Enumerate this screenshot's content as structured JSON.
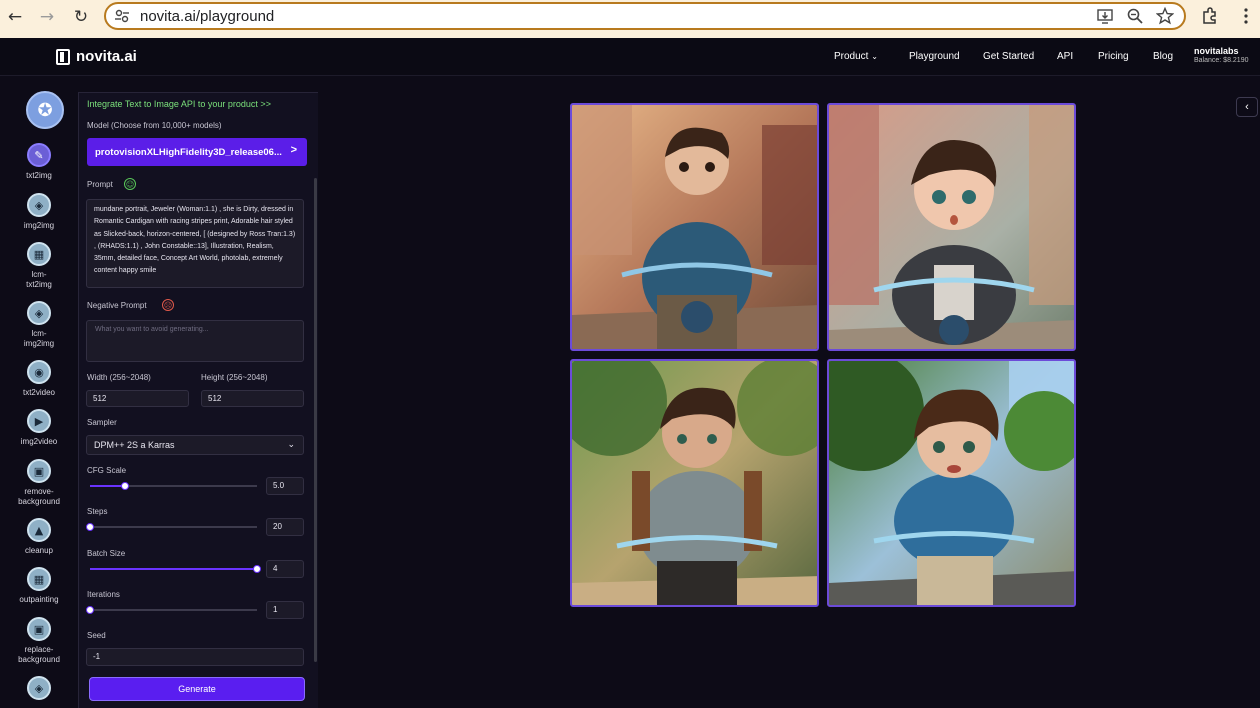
{
  "browser": {
    "url": "novita.ai/playground",
    "back_icon": "←",
    "forward_icon": "→",
    "reload_icon": "↻"
  },
  "header": {
    "logo": "novita.ai",
    "nav": [
      "Product",
      "Playground",
      "Get Started",
      "API",
      "Pricing",
      "Blog"
    ],
    "account_name": "novitalabs",
    "balance": "Balance: $8.2190"
  },
  "tools": [
    {
      "label": "txt2img",
      "active": true
    },
    {
      "label": "img2img"
    },
    {
      "label": "lcm-\ntxt2img"
    },
    {
      "label": "lcm-\nimg2img"
    },
    {
      "label": "txt2video"
    },
    {
      "label": "img2video"
    },
    {
      "label": "remove-\nbackground"
    },
    {
      "label": "cleanup"
    },
    {
      "label": "outpainting"
    },
    {
      "label": "replace-\nbackground"
    }
  ],
  "panel": {
    "promo": "Integrate Text to Image API to your product >>",
    "model_label": "Model (Choose from 10,000+ models)",
    "model_value": "protovisionXLHighFidelity3D_release06...",
    "prompt_label": "Prompt",
    "prompt_value": "mundane portrait, Jeweler (Woman:1.1) , she is Dirty, dressed in Romantic Cardigan with racing stripes print, Adorable hair styled as Slicked-back, horizon-centered, [ (designed by Ross Tran:1.3) , (RHADS:1.1) , John Constable::13], Illustration, Realism, 35mm, detailed face, Concept Art World, photolab, extremely content happy smile",
    "negative_label": "Negative Prompt",
    "negative_placeholder": "What you want to avoid generating...",
    "width_label": "Width (256~2048)",
    "width_value": "512",
    "height_label": "Height (256~2048)",
    "height_value": "512",
    "sampler_label": "Sampler",
    "sampler_value": "DPM++ 2S a Karras",
    "cfg_label": "CFG Scale",
    "cfg_value": "5.0",
    "cfg_fraction": 0.21,
    "steps_label": "Steps",
    "steps_value": "20",
    "steps_fraction": 0.0,
    "batch_label": "Batch Size",
    "batch_value": "4",
    "batch_fraction": 1.0,
    "iter_label": "Iterations",
    "iter_value": "1",
    "iter_fraction": 0.0,
    "seed_label": "Seed",
    "seed_value": "-1",
    "generate_label": "Generate"
  },
  "results": {
    "image_count": 4,
    "collapse_icon": "‹"
  }
}
